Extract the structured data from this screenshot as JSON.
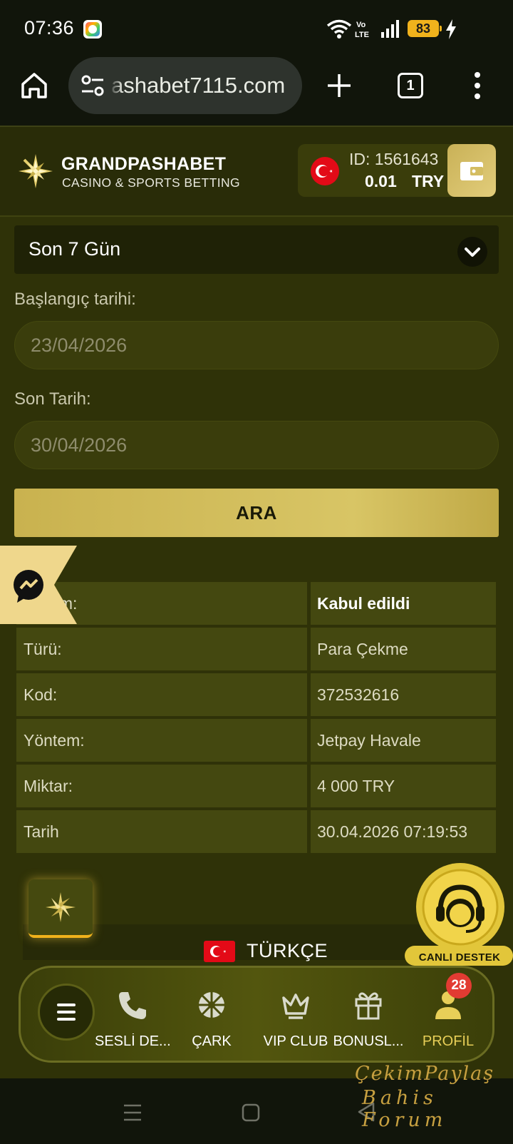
{
  "status_bar": {
    "time": "07:36",
    "network_label": "Vo LTE",
    "battery_level": "83",
    "icons": [
      "app-notification-icon",
      "wifi-icon",
      "volte-icon",
      "signal-icon",
      "battery-icon",
      "charging-icon"
    ]
  },
  "browser": {
    "url": "ashabet7115.com",
    "tab_count": "1",
    "icons": [
      "home-icon",
      "site-settings-icon",
      "new-tab-icon",
      "tabs-icon",
      "more-menu-icon"
    ]
  },
  "header": {
    "brand_name": "GRANDPASHABET",
    "brand_tagline": "CASINO & SPORTS BETTING",
    "account_id": "ID: 1561643",
    "balance": "0.01",
    "currency": "TRY"
  },
  "filters": {
    "period_value": "Son 7 Gün",
    "start_label": "Başlangıç tarihi:",
    "start_date": "23/04/2026",
    "end_label": "Son Tarih:",
    "end_date": "30/04/2026",
    "search_label": "ARA"
  },
  "details": [
    {
      "key": "Durum:",
      "value": "Kabul edildi"
    },
    {
      "key": "Türü:",
      "value": "Para Çekme"
    },
    {
      "key": "Kod:",
      "value": "372532616"
    },
    {
      "key": "Yöntem:",
      "value": "Jetpay Havale"
    },
    {
      "key": "Miktar:",
      "value": "4 000 TRY"
    },
    {
      "key": "Tarih",
      "value": "30.04.2026 07:19:53"
    }
  ],
  "footer": {
    "language": "TÜRKÇE",
    "support_label": "CANLI DESTEK"
  },
  "bottom_nav": {
    "items": [
      {
        "label": "SESLİ DE...",
        "icon": "phone-icon"
      },
      {
        "label": "ÇARK",
        "icon": "wheel-icon"
      },
      {
        "label": "VIP CLUB",
        "icon": "crown-icon"
      },
      {
        "label": "BONUSL...",
        "icon": "gift-icon"
      },
      {
        "label": "PROFİL",
        "icon": "profile-icon"
      }
    ],
    "profile_badge": "28"
  },
  "watermark": {
    "line1": "ÇekimPaylaş",
    "line2": "Bahis Forum"
  },
  "colors": {
    "page_bg": "#2f3208",
    "accent_gold": "#d4bf5c",
    "status_green": "#444810",
    "badge_red": "#e23b32"
  }
}
